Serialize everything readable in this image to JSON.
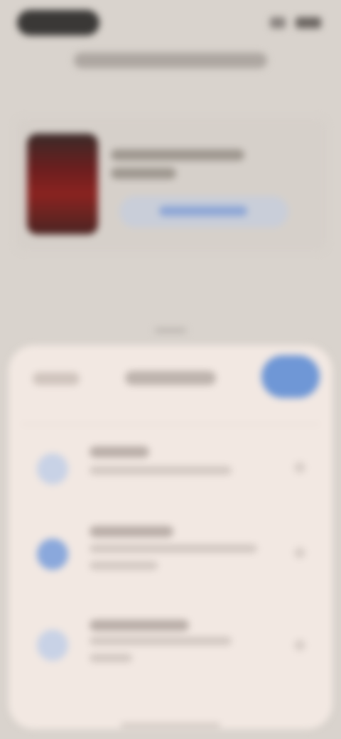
{
  "status_bar": {
    "time": "",
    "icons": [
      "signal-icon",
      "battery-icon"
    ]
  },
  "header": {
    "title": ""
  },
  "product": {
    "name": "",
    "button_label": ""
  },
  "sheet": {
    "cancel_label": "",
    "title": "",
    "done_label": "",
    "options": [
      {
        "title": "",
        "description": "",
        "icon": "option-icon"
      },
      {
        "title": "",
        "description": "",
        "icon": "option-icon-selected"
      },
      {
        "title": "",
        "description": "",
        "icon": "option-icon"
      }
    ]
  },
  "colors": {
    "background": "#d9d3cd",
    "sheet": "#f2e8e2",
    "accent": "#6f97d6",
    "product_image": "#8a2320"
  }
}
